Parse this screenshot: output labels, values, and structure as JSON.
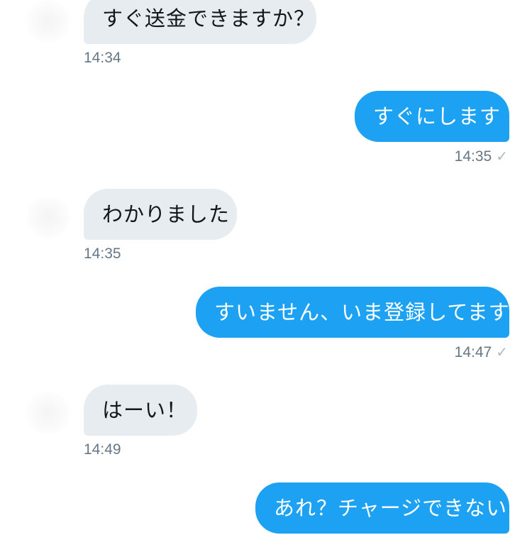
{
  "messages": [
    {
      "direction": "in",
      "text": "すぐ送金できますか？",
      "time": "14:34"
    },
    {
      "direction": "out",
      "text": "すぐにします",
      "time": "14:35"
    },
    {
      "direction": "in",
      "text": "わかりました",
      "time": "14:35"
    },
    {
      "direction": "out",
      "text": "すいません、いま登録してます",
      "time": "14:47"
    },
    {
      "direction": "in",
      "text": "はーい！",
      "time": "14:49"
    },
    {
      "direction": "out",
      "text": "あれ？チャージできない",
      "time": ""
    }
  ],
  "read_receipt_glyph": "✓",
  "colors": {
    "incoming_bubble": "#e6ecf0",
    "outgoing_bubble": "#1da1f2",
    "timestamp": "#657786"
  }
}
